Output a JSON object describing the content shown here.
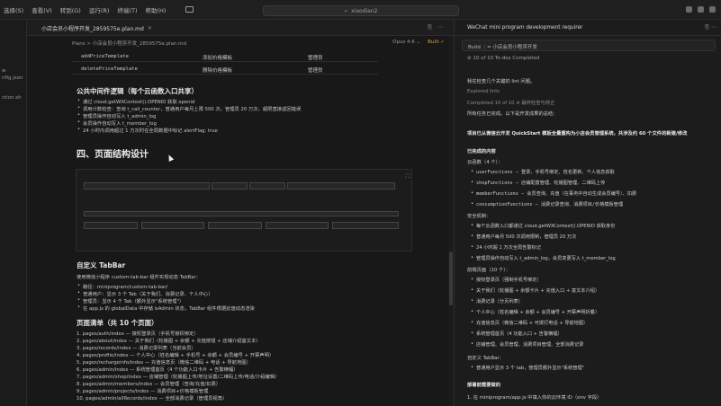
{
  "menu": {
    "items": [
      "选择(S)",
      "查看(V)",
      "转到(G)",
      "运行(R)",
      "终端(T)",
      "帮助(H)"
    ]
  },
  "search": {
    "text": "xiaodian2"
  },
  "sidebar": {
    "texts": [
      "w",
      "nfig.json",
      "ction.sh"
    ]
  },
  "tab": {
    "label": "小店会员小程序开发_2859575e.plan.md",
    "close": "×"
  },
  "breadcrumb": {
    "text": "Plans > 小店会员小程序开发_2859575e.plan.md",
    "model": "Opus 4.6 ⌄",
    "build": "Built ✓",
    "check": "✓"
  },
  "table": {
    "rows": [
      {
        "name": "addPriceTemplate",
        "desc": "添加价格模板",
        "role": "管理员"
      },
      {
        "name": "deletePriceTemplate",
        "desc": "删除价格模板",
        "role": "管理员"
      }
    ]
  },
  "doc": {
    "section1_title": "公共中间件逻辑（每个云函数入口共享）",
    "section1_bullets": [
      "通过 cloud.getWXContext().OPENID 获取 openid",
      "调用计数检查：查询 t_call_counter，普通用户每月上限 500 次，管理员 20 万次，超限直接返回错误",
      "管理员操作自动写入 t_admin_log",
      "会员操作自动写入 t_member_log",
      "24 小时内调用超过 1 万次时在全局数据中标记 alertFlag: true"
    ],
    "section2_title": "四、页面结构设计",
    "zoom_icon": "⛶",
    "tabbar_title": "自定义 TabBar",
    "tabbar_intro": "使用微信小程序 custom-tab-bar 组件实现动态 TabBar：",
    "tabbar_bullets": [
      "路径：miniprogram/custom-tab-bar/",
      "普通用户：显示 3 个 Tab（关于我们、消费记录、个人中心）",
      "管理员：显示 4 个 Tab（额外显示\"系统管理\"）",
      "在 app.js 的 globalData 中存储 isAdmin 状态，TabBar 组件根据此值动态渲染"
    ],
    "pages_title": "页面清单（共 10 个页面）",
    "pages": [
      "1. pages/auth/index — 授权登录页（手机号授权绑定）",
      "2. pages/about/index — 关于我们（轮播图 + 余额 + 充值按钮 + 店铺介绍富文本）",
      "3. pages/records/index — 消费记录列表（当前会员）",
      "4. pages/profile/index — 个人中心（姓名编辑 + 手机号 + 余额 + 会员编号 + 开票声明）",
      "5. pages/rechargeinfo/index — 充值信息页（微信二维码 + 电话 + 导航地图）",
      "6. pages/admin/index — 系统管理首页（4 个功能入口卡片 + 告警横幅）",
      "7. pages/admin/shop/index — 店铺管理（轮播图上传/地址设置/二维码上传/电话/介绍编辑）",
      "8. pages/admin/members/index — 会员管理（查询/充值/扣费）",
      "9. pages/admin/projects/index — 消费项目+价格模板管理",
      "10. pages/admin/allRecords/index — 全部消费记录（管理员视角）"
    ]
  },
  "chat": {
    "header": "WeChat mini program development requirer",
    "header_icons": "⎘ ⋯",
    "build_line": "Build  ⋮= 小店会员小程序开发",
    "todos": "⊘  10 of 10 To-dos Completed",
    "lines": [
      {
        "t": "我在检查几个关键的 lint 问题。",
        "cls": ""
      },
      {
        "t": "Explored lints",
        "cls": "dim"
      },
      {
        "t": "Completed 10 of 10  ⊘ 最终检查与修正",
        "cls": "dim"
      },
      {
        "t": "所有任务已完成。以下是开发成果的总结：",
        "cls": ""
      },
      {
        "t": "项目已从微信云开发 QuickStart 模板全量重构为小店会员管理系统，共涉及约 60 个文件的新建/修改",
        "cls": "b"
      },
      {
        "t": "已完成的内容",
        "cls": "b"
      },
      {
        "t": "云函数（4 个）：",
        "cls": ""
      }
    ],
    "cf": [
      "userFunctions — 登录、手机号绑定、姓名更新、个人信息获取",
      "shopFunctions — 店铺配置管理、轮播图管理、二维码上传",
      "memberFunctions — 会员查询、充值（在事务中自动生成会员编号）、扣费",
      "consumptionFunctions — 消费记录查询、消费项目/价格模板管理"
    ],
    "sec_title": "安全机制：",
    "sec": [
      "每个云函数入口都通过 cloud.getWXContext().OPENID 获取身份",
      "普通用户每月 500 次调用限制，管理员 20 万次",
      "24 小时超 1 万次全局告警标记",
      "管理员操作自动写入 t_admin_log，会员变更写入 t_member_log"
    ],
    "pages_title": "前端页面（10 个）：",
    "pages": [
      "授权登录页（强制手机号绑定）",
      "关于我们（轮播图 + 余额卡片 + 充值入口 + 富文本介绍）",
      "消费记录（分页列表）",
      "个人中心（姓名编辑 + 余额 + 会员编号 + 开票声明折叠）",
      "充值信息页（微信二维码 + 可拨打电话 + 导航地图）",
      "系统管理首页（4 功能入口 + 告警横幅）",
      "店铺管理、会员管理、消费项目管理、全部消费记录"
    ],
    "tab_title": "自定义 TabBar：",
    "tab": [
      "普通用户显示 3 个 tab，管理员额外显示\"系统管理\""
    ],
    "deploy_title": "部署前需要做的",
    "deploy": [
      "1. 在 miniprogram/app.js 中填入你的云环境 ID（env 字段）"
    ]
  }
}
